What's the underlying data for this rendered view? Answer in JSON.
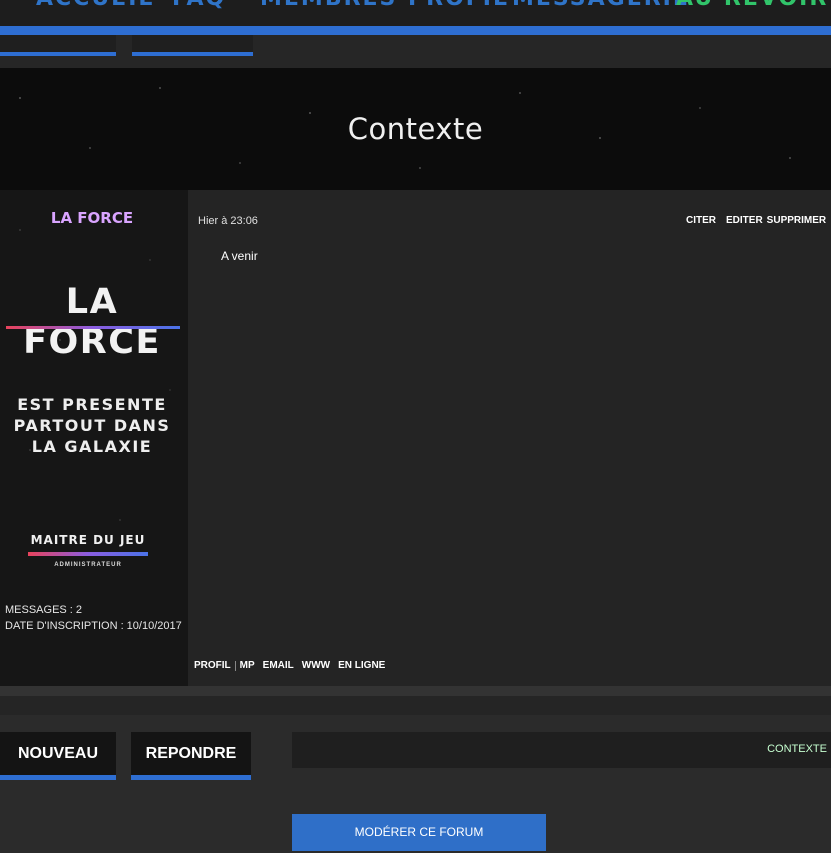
{
  "nav": {
    "items": [
      {
        "label": "ACCUEIL"
      },
      {
        "label": "FAQ"
      },
      {
        "label": "MEMBRES"
      },
      {
        "label": "PROFIL"
      },
      {
        "label": "MESSAGERIE"
      },
      {
        "label": "AU REVOIR"
      }
    ],
    "accent": "#2e6ed2",
    "highlight": "#31c46a"
  },
  "page": {
    "title": "Contexte"
  },
  "post": {
    "username": "LA FORCE",
    "avatar": {
      "title": "LA FORCE",
      "tagline": [
        "EST PRESENTE",
        "PARTOUT DANS",
        "LA GALAXIE"
      ]
    },
    "rank": {
      "title": "MAITRE DU JEU",
      "subtitle": "ADMINISTRATEUR"
    },
    "stats": {
      "messages": "MESSAGES : 2",
      "joined": "DATE D'INSCRIPTION : 10/10/2017"
    },
    "date": "Hier à 23:06",
    "actions": {
      "quote": "CITER",
      "edit": "EDITER",
      "delete": "SUPPRIMER"
    },
    "body": "A venir",
    "contact": {
      "profile": "PROFIL",
      "pm": "MP",
      "email": "EMAIL",
      "www": "WWW",
      "online": "EN LIGNE"
    }
  },
  "footer": {
    "new_label": "NOUVEAU",
    "reply_label": "REPONDRE",
    "breadcrumb": "CONTEXTE",
    "moderate_label": "MODÉRER CE FORUM"
  }
}
